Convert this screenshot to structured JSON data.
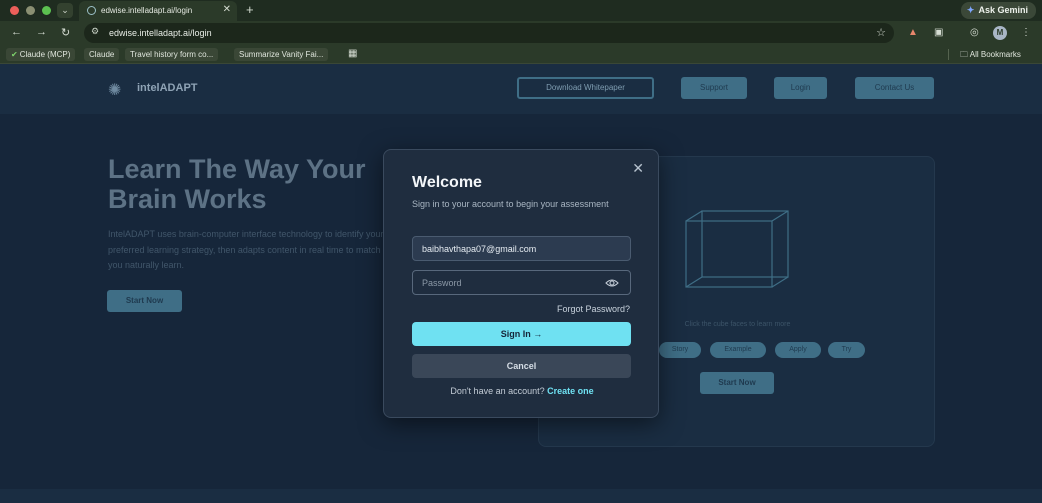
{
  "browser": {
    "tab_title": "edwise.intelladapt.ai/login",
    "url": "edwise.intelladapt.ai/login",
    "ask_gemini": "Ask Gemini",
    "profile_initial": "M",
    "bookmarks": [
      {
        "label": "Claude (MCP)"
      },
      {
        "label": "Claude"
      },
      {
        "label": "Travel history form co..."
      },
      {
        "label": "Summarize Vanity Fai..."
      }
    ],
    "all_bookmarks": "All Bookmarks"
  },
  "site": {
    "logo": "intelADAPT",
    "header_buttons": {
      "whitepaper": "Download Whitepaper",
      "support": "Support",
      "login": "Login",
      "contact": "Contact Us"
    },
    "hero_title": "Learn The Way Your Brain Works",
    "hero_desc": "IntelADAPT uses brain-computer interface technology to identify your preferred learning strategy, then adapts content in real time to match how you naturally learn.",
    "hero_cta": "Start Now",
    "card": {
      "hint": "Click the cube faces to learn more",
      "pills": [
        "Story",
        "Example",
        "Apply",
        "Try"
      ],
      "cta": "Start Now"
    }
  },
  "modal": {
    "title": "Welcome",
    "subtitle": "Sign in to your account to begin your assessment",
    "email_value": "baibhavthapa07@gmail.com",
    "password_placeholder": "Password",
    "forgot": "Forgot Password?",
    "signin": "Sign In",
    "cancel": "Cancel",
    "signup_prompt": "Don't have an account?",
    "signup_link": "Create one"
  }
}
